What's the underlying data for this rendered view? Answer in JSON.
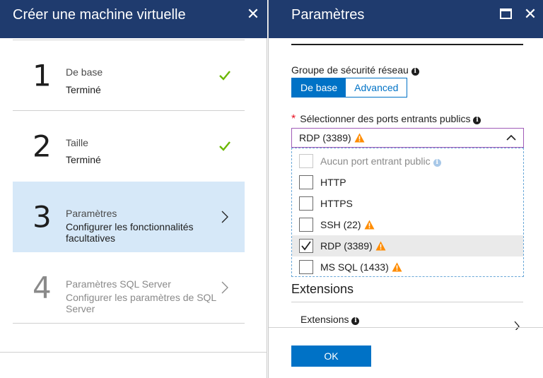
{
  "left_blade": {
    "title": "Créer une machine virtuelle",
    "close_glyph": "✕",
    "steps": [
      {
        "number": "1",
        "title": "De base",
        "subtitle": "Terminé",
        "status": "done",
        "icon": "checkmark-icon"
      },
      {
        "number": "2",
        "title": "Taille",
        "subtitle": "Terminé",
        "status": "done",
        "icon": "checkmark-icon"
      },
      {
        "number": "3",
        "title": "Paramètres",
        "subtitle": "Configurer les fonctionnalités facultatives",
        "status": "active",
        "icon": "chevron-right-icon"
      },
      {
        "number": "4",
        "title": "Paramètres SQL Server",
        "subtitle": "Configurer les paramètres de SQL Server",
        "status": "disabled",
        "icon": "chevron-right-icon"
      }
    ]
  },
  "right_blade": {
    "title": "Paramètres",
    "close_glyph": "✕",
    "nsg": {
      "label": "Groupe de sécurité réseau",
      "options": [
        "De base",
        "Advanced"
      ],
      "selected": "De base"
    },
    "ports": {
      "required_mark": "*",
      "label": "Sélectionner des ports entrants publics",
      "value": "RDP (3389)",
      "options": [
        {
          "label": "Aucun port entrant public",
          "checked": false,
          "disabled": true,
          "warning": false,
          "info": true
        },
        {
          "label": "HTTP",
          "checked": false,
          "disabled": false,
          "warning": false,
          "info": false
        },
        {
          "label": "HTTPS",
          "checked": false,
          "disabled": false,
          "warning": false,
          "info": false
        },
        {
          "label": "SSH (22)",
          "checked": false,
          "disabled": false,
          "warning": true,
          "info": false
        },
        {
          "label": "RDP (3389)",
          "checked": true,
          "disabled": false,
          "warning": true,
          "info": false
        },
        {
          "label": "MS SQL (1433)",
          "checked": false,
          "disabled": false,
          "warning": true,
          "info": false
        }
      ]
    },
    "extensions": {
      "section_title": "Extensions",
      "row_label": "Extensions"
    },
    "ok_label": "OK"
  },
  "colors": {
    "header_bg": "#1f3b6e",
    "accent": "#0072c6",
    "check_green": "#6bb700",
    "warning_orange": "#ff8c00",
    "active_step_bg": "#d6e8f8",
    "required_red": "#e81123"
  },
  "info_glyph": "i"
}
